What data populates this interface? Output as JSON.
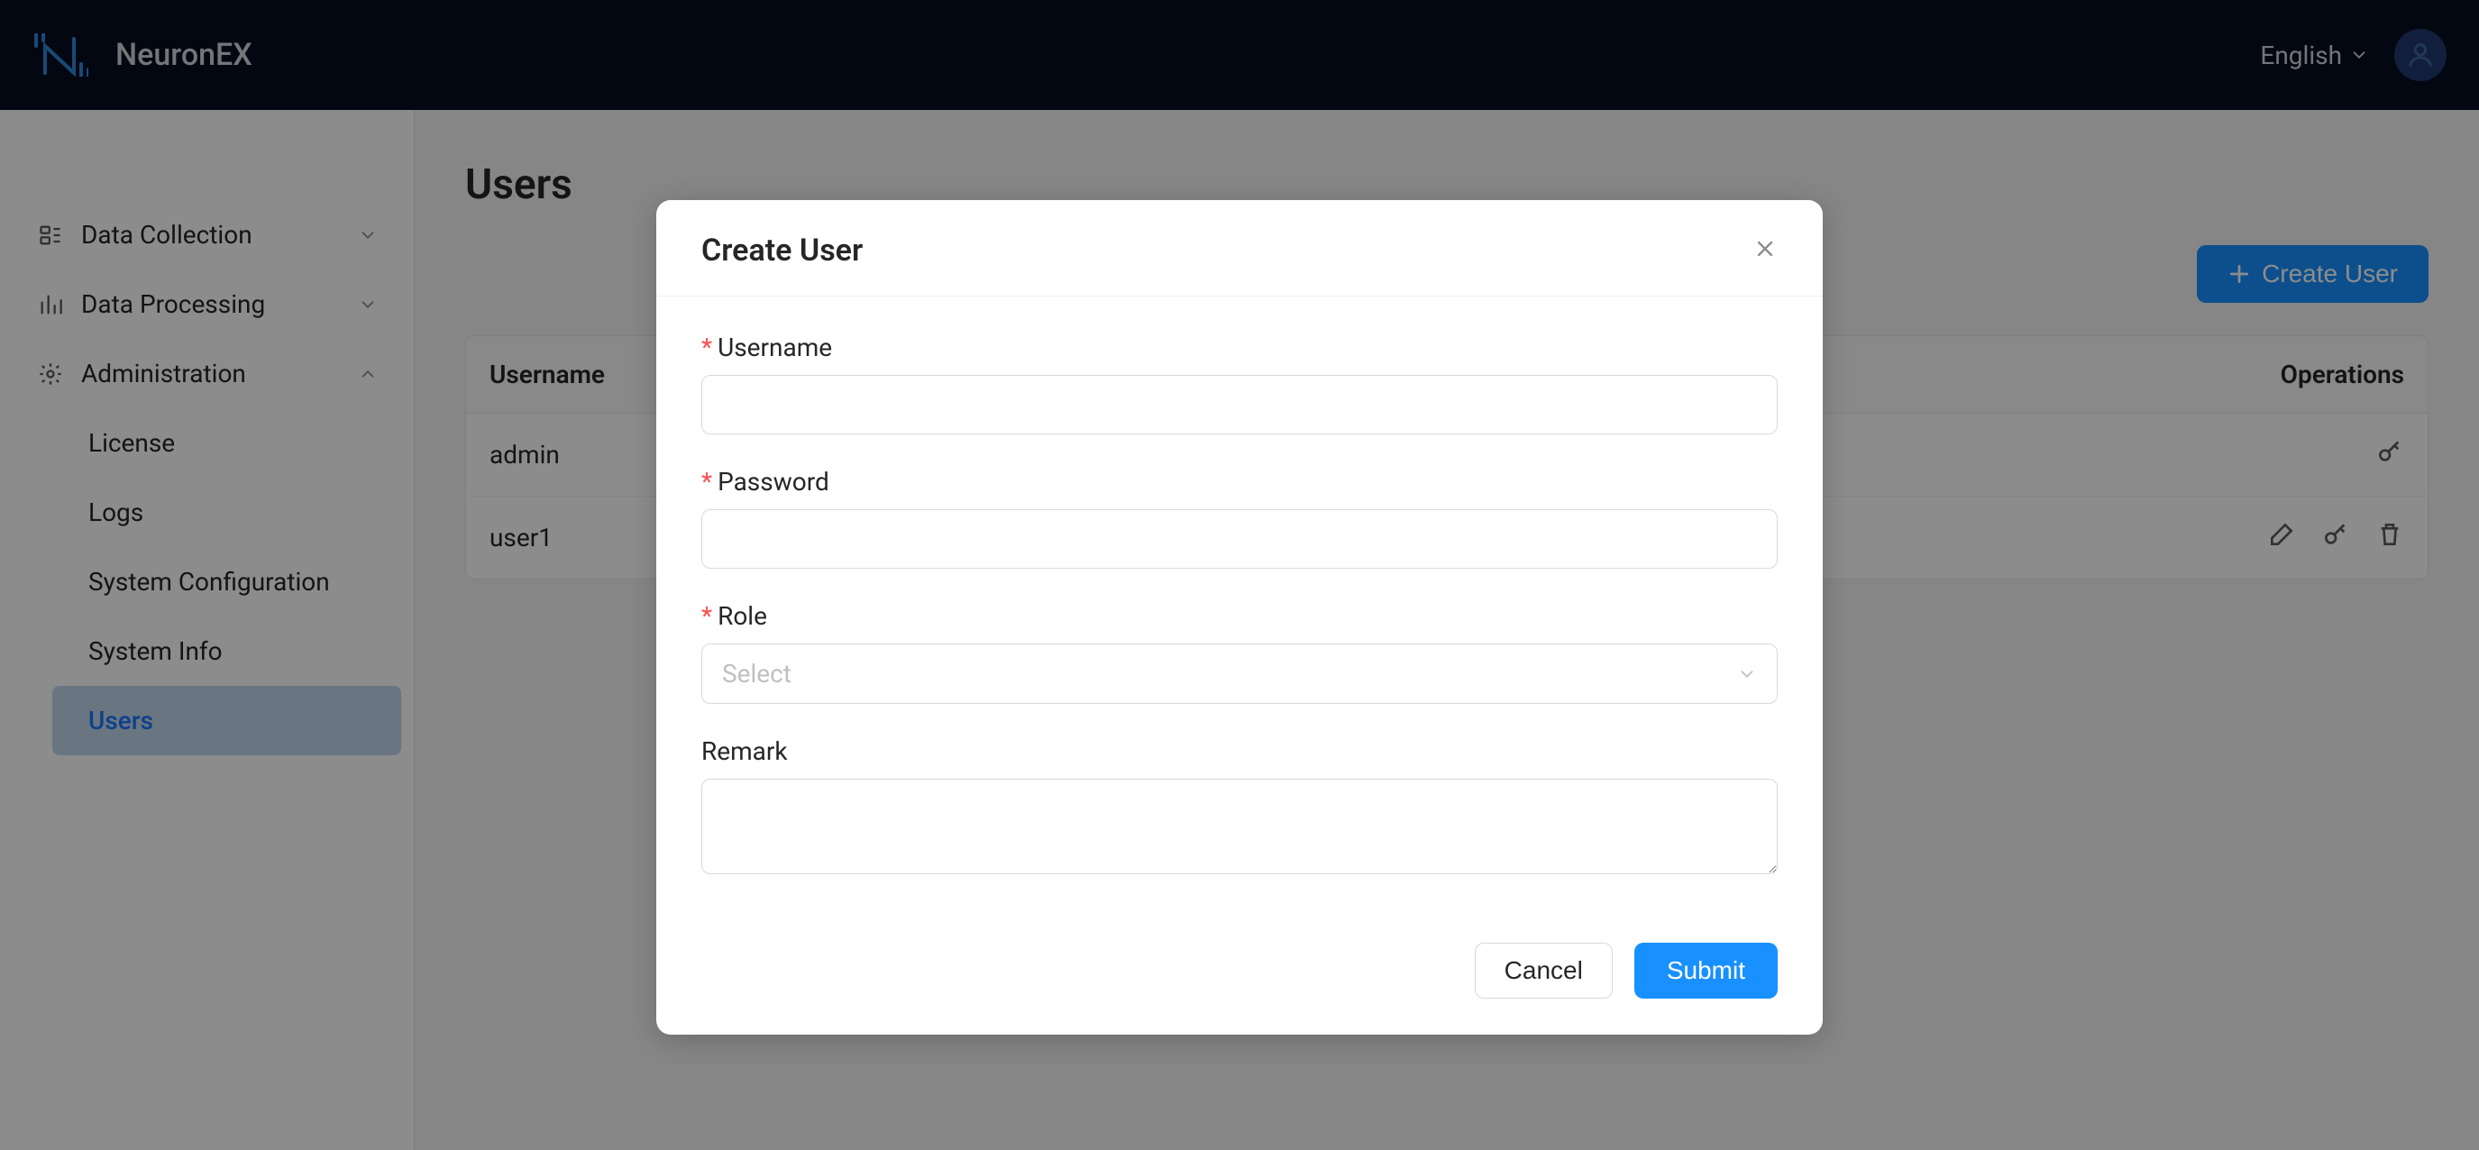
{
  "header": {
    "brand": "NeuronEX",
    "language": "English"
  },
  "sidebar": {
    "items": [
      {
        "label": "Data Collection",
        "expanded": false
      },
      {
        "label": "Data Processing",
        "expanded": false
      },
      {
        "label": "Administration",
        "expanded": true,
        "children": [
          {
            "label": "License"
          },
          {
            "label": "Logs"
          },
          {
            "label": "System Configuration"
          },
          {
            "label": "System Info"
          },
          {
            "label": "Users",
            "active": true
          }
        ]
      }
    ]
  },
  "page": {
    "title": "Users",
    "create_button": "Create User"
  },
  "table": {
    "columns": {
      "username": "Username",
      "operations": "Operations"
    },
    "rows": [
      {
        "username": "admin",
        "actions": [
          "key"
        ]
      },
      {
        "username": "user1",
        "actions": [
          "edit",
          "key",
          "delete"
        ]
      }
    ]
  },
  "modal": {
    "title": "Create User",
    "fields": {
      "username": {
        "label": "Username",
        "required": true,
        "value": ""
      },
      "password": {
        "label": "Password",
        "required": true,
        "value": ""
      },
      "role": {
        "label": "Role",
        "required": true,
        "placeholder": "Select"
      },
      "remark": {
        "label": "Remark",
        "required": false,
        "value": ""
      }
    },
    "cancel": "Cancel",
    "submit": "Submit"
  }
}
